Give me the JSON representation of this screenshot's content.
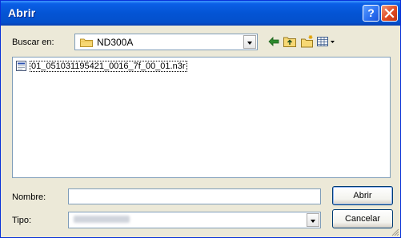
{
  "window": {
    "title": "Abrir",
    "help_label": "?"
  },
  "look_in": {
    "label": "Buscar en:",
    "value": "ND300A"
  },
  "toolbar": {
    "back_icon": "back-arrow-icon",
    "up_icon": "up-folder-icon",
    "new_folder_icon": "new-folder-icon",
    "view_icon": "view-menu-icon"
  },
  "files": [
    {
      "name": "01_051031195421_0016_7f_00_01.n3r",
      "icon": "document-icon"
    }
  ],
  "filename": {
    "label": "Nombre:",
    "value": ""
  },
  "filetype": {
    "label": "Tipo:",
    "value": ""
  },
  "buttons": {
    "open": "Abrir",
    "cancel": "Cancelar"
  },
  "colors": {
    "titlebar": "#0454d4",
    "dialog_bg": "#ece9d8",
    "field_border": "#7f9db9",
    "close_button": "#e04a22"
  }
}
